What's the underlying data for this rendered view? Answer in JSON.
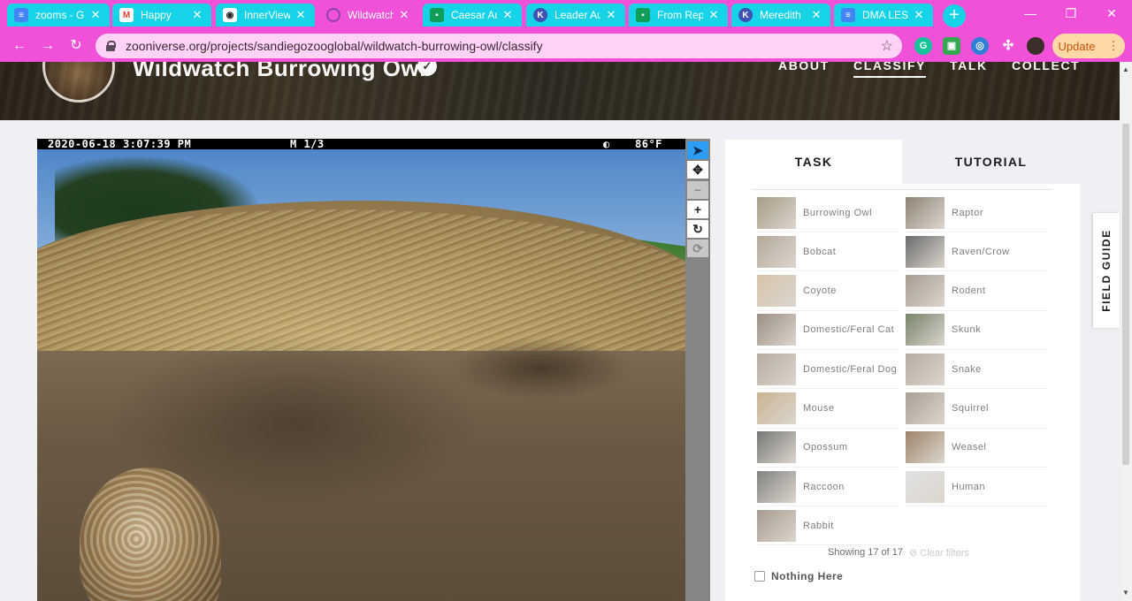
{
  "browser": {
    "tabs": [
      {
        "label": "zooms - G",
        "icon": "docs-icon",
        "color": "#4285f4"
      },
      {
        "label": "Happy",
        "icon": "gmail-icon",
        "color": "#ea4335"
      },
      {
        "label": "InnerView",
        "icon": "innerview-icon",
        "color": "#222222"
      },
      {
        "label": "Wildwatch",
        "icon": "zooniverse-icon",
        "color": "#9b59b6"
      },
      {
        "label": "Caesar Au",
        "icon": "classroom-icon",
        "color": "#0f9d58"
      },
      {
        "label": "Leader Au",
        "icon": "kami-icon",
        "color": "#3f51b5"
      },
      {
        "label": "From Rep",
        "icon": "classroom-icon",
        "color": "#0f9d58"
      },
      {
        "label": "Meredith",
        "icon": "kami-icon",
        "color": "#3f51b5"
      },
      {
        "label": "DMA LESS",
        "icon": "docs-icon",
        "color": "#4285f4"
      }
    ],
    "url": "zooniverse.org/projects/sandiegozooglobal/wildwatch-burrowing-owl/classify",
    "update_label": "Update"
  },
  "project": {
    "title": "Wildwatch Burrowing Owl",
    "nav": [
      "ABOUT",
      "CLASSIFY",
      "TALK",
      "COLLECT"
    ],
    "active_nav": "CLASSIFY"
  },
  "subject": {
    "stamp_date": "2020-06-18 3:07:39 PM",
    "stamp_mode": "M 1/3",
    "stamp_temp": "86°F"
  },
  "task_panel": {
    "tabs": [
      "TASK",
      "TUTORIAL"
    ],
    "choices": [
      {
        "label": "Burrowing Owl",
        "color": "#8a7a60"
      },
      {
        "label": "Raptor",
        "color": "#6a5c48"
      },
      {
        "label": "Bobcat",
        "color": "#9a8c78"
      },
      {
        "label": "Raven/Crow",
        "color": "#3a3a3a"
      },
      {
        "label": "Coyote",
        "color": "#c8b090"
      },
      {
        "label": "Rodent",
        "color": "#8a7a6a"
      },
      {
        "label": "Domestic/Feral Cat",
        "color": "#7a6a5a"
      },
      {
        "label": "Skunk",
        "color": "#4a5a3a"
      },
      {
        "label": "Domestic/Feral Dog",
        "color": "#a09080"
      },
      {
        "label": "Snake",
        "color": "#9a9080"
      },
      {
        "label": "Mouse",
        "color": "#b89a70"
      },
      {
        "label": "Squirrel",
        "color": "#8a8070"
      },
      {
        "label": "Opossum",
        "color": "#4a4a48"
      },
      {
        "label": "Weasel",
        "color": "#7a5a3a"
      },
      {
        "label": "Raccoon",
        "color": "#5a5a58"
      },
      {
        "label": "Human",
        "color": "#d8d8d8"
      },
      {
        "label": "Rabbit",
        "color": "#8a7a6a"
      }
    ],
    "showing": "Showing 17 of 17",
    "clear_filters": "Clear filters",
    "nothing_here": "Nothing Here"
  },
  "field_guide_label": "FIELD GUIDE"
}
